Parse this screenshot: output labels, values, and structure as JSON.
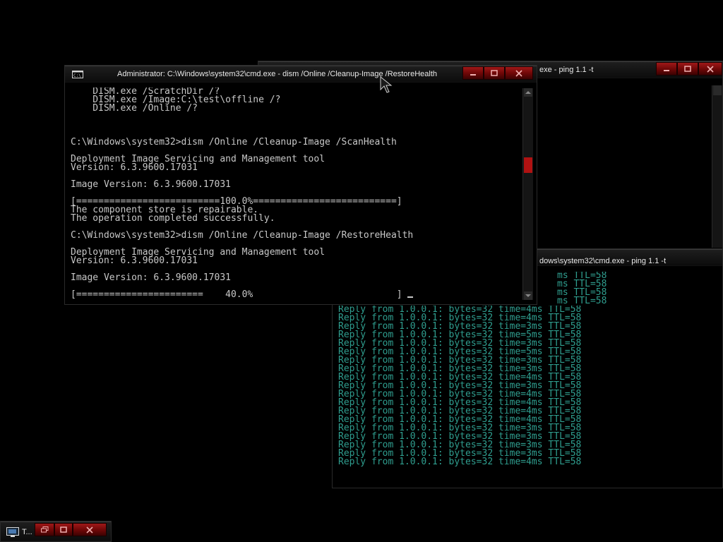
{
  "dism_window": {
    "title": "Administrator: C:\\Windows\\system32\\cmd.exe - dism  /Online /Cleanup-Image /RestoreHealth",
    "lines": [
      "    DISM.exe /ScratchDir /?",
      "    DISM.exe /Image:C:\\test\\offline /?",
      "    DISM.exe /Online /?",
      "",
      "",
      "",
      "C:\\Windows\\system32>dism /Online /Cleanup-Image /ScanHealth",
      "",
      "Deployment Image Servicing and Management tool",
      "Version: 6.3.9600.17031",
      "",
      "Image Version: 6.3.9600.17031",
      "",
      "[==========================100.0%==========================]",
      "The component store is repairable.",
      "The operation completed successfully.",
      "",
      "C:\\Windows\\system32>dism /Online /Cleanup-Image /RestoreHealth",
      "",
      "Deployment Image Servicing and Management tool",
      "Version: 6.3.9600.17031",
      "",
      "Image Version: 6.3.9600.17031",
      "",
      "[=======================    40.0%                          ]"
    ],
    "progress_percent": 40.0
  },
  "ping_window_top": {
    "title": "exe - ping  1.1 -t"
  },
  "ping_window_bottom": {
    "title": "dows\\system32\\cmd.exe - ping  1.1 -t",
    "partial_lines": [
      "ms TTL=58",
      "ms TTL=58",
      "ms TTL=58",
      "ms TTL=58"
    ],
    "lines": [
      "Reply from 1.0.0.1: bytes=32 time=4ms TTL=58",
      "Reply from 1.0.0.1: bytes=32 time=4ms TTL=58",
      "Reply from 1.0.0.1: bytes=32 time=3ms TTL=58",
      "Reply from 1.0.0.1: bytes=32 time=5ms TTL=58",
      "Reply from 1.0.0.1: bytes=32 time=3ms TTL=58",
      "Reply from 1.0.0.1: bytes=32 time=5ms TTL=58",
      "Reply from 1.0.0.1: bytes=32 time=3ms TTL=58",
      "Reply from 1.0.0.1: bytes=32 time=3ms TTL=58",
      "Reply from 1.0.0.1: bytes=32 time=4ms TTL=58",
      "Reply from 1.0.0.1: bytes=32 time=3ms TTL=58",
      "Reply from 1.0.0.1: bytes=32 time=4ms TTL=58",
      "Reply from 1.0.0.1: bytes=32 time=4ms TTL=58",
      "Reply from 1.0.0.1: bytes=32 time=4ms TTL=58",
      "Reply from 1.0.0.1: bytes=32 time=4ms TTL=58",
      "Reply from 1.0.0.1: bytes=32 time=3ms TTL=58",
      "Reply from 1.0.0.1: bytes=32 time=3ms TTL=58",
      "Reply from 1.0.0.1: bytes=32 time=3ms TTL=58",
      "Reply from 1.0.0.1: bytes=32 time=3ms TTL=58",
      "Reply from 1.0.0.1: bytes=32 time=4ms TTL=58"
    ]
  },
  "minimized_window": {
    "label": "T..."
  },
  "colors": {
    "console_text": "#c8c8c8",
    "ping_text": "#2f9e8f",
    "control_red": "#8a0c0c"
  },
  "icons": {
    "minimize": "minimize-icon",
    "maximize": "maximize-icon",
    "close": "close-icon",
    "console": "console-icon"
  }
}
